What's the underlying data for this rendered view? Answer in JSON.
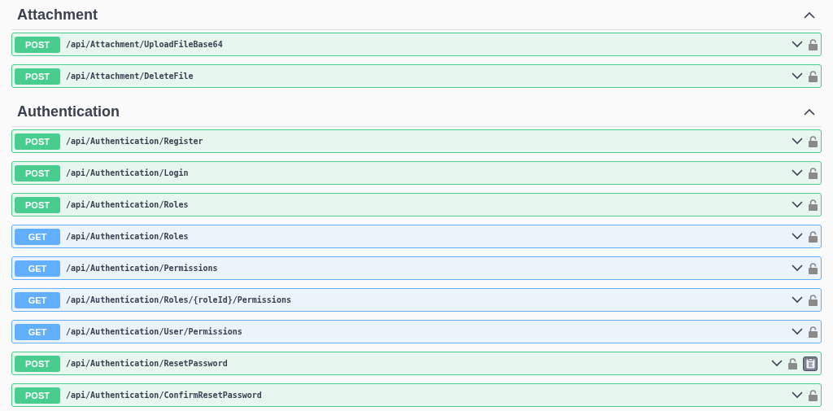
{
  "sections": [
    {
      "title": "Attachment",
      "expanded": true,
      "operations": [
        {
          "method": "POST",
          "path": "/api/Attachment/UploadFileBase64",
          "copy_button": false
        },
        {
          "method": "POST",
          "path": "/api/Attachment/DeleteFile",
          "copy_button": false
        }
      ]
    },
    {
      "title": "Authentication",
      "expanded": true,
      "operations": [
        {
          "method": "POST",
          "path": "/api/Authentication/Register",
          "copy_button": false
        },
        {
          "method": "POST",
          "path": "/api/Authentication/Login",
          "copy_button": false
        },
        {
          "method": "POST",
          "path": "/api/Authentication/Roles",
          "copy_button": false
        },
        {
          "method": "GET",
          "path": "/api/Authentication/Roles",
          "copy_button": false
        },
        {
          "method": "GET",
          "path": "/api/Authentication/Permissions",
          "copy_button": false
        },
        {
          "method": "GET",
          "path": "/api/Authentication/Roles/{roleId}/Permissions",
          "copy_button": false
        },
        {
          "method": "GET",
          "path": "/api/Authentication/User/Permissions",
          "copy_button": false
        },
        {
          "method": "POST",
          "path": "/api/Authentication/ResetPassword",
          "copy_button": true
        },
        {
          "method": "POST",
          "path": "/api/Authentication/ConfirmResetPassword",
          "copy_button": false
        }
      ]
    }
  ]
}
